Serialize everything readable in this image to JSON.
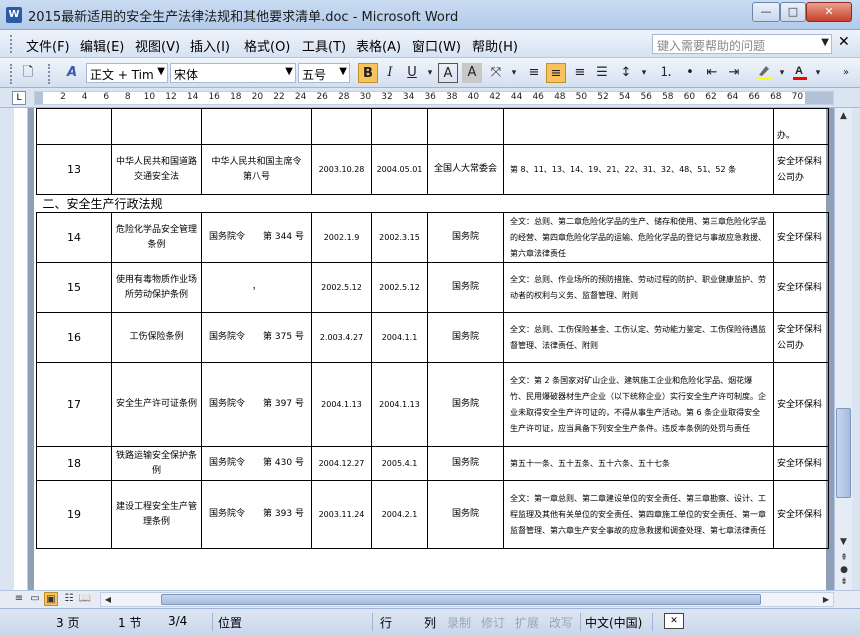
{
  "window": {
    "title": "2015最新适用的安全生产法律法规和其他要求清单.doc - Microsoft Word",
    "app_icon": "W",
    "minimize_glyph": "—",
    "maximize_glyph": "□",
    "close_glyph": "✕"
  },
  "menu": {
    "items": [
      "文件(F)",
      "编辑(E)",
      "视图(V)",
      "插入(I)",
      "格式(O)",
      "工具(T)",
      "表格(A)",
      "窗口(W)",
      "帮助(H)"
    ],
    "help_placeholder": "键入需要帮助的问题"
  },
  "toolbar": {
    "style": "正文 + Tim",
    "font": "宋体",
    "size": "五号",
    "bold": "B",
    "italic": "I",
    "underline": "U",
    "font_color_swatch": "#ff0000",
    "highlight_swatch": "#ffff00"
  },
  "ruler": {
    "corner": "L",
    "numbers": [
      "2",
      "4",
      "6",
      "8",
      "10",
      "12",
      "14",
      "16",
      "18",
      "20",
      "22",
      "24",
      "26",
      "28",
      "30",
      "32",
      "34",
      "36",
      "38",
      "40",
      "42",
      "44",
      "46",
      "48",
      "50",
      "52",
      "54",
      "56",
      "58",
      "60",
      "62",
      "64",
      "66",
      "68",
      "70"
    ]
  },
  "document": {
    "section_title": "二、安全生产行政法规",
    "top_row": {
      "dept": "办。"
    },
    "row13": {
      "no": "13",
      "name": "中华人民共和国道路交通安全法",
      "doc": "中华人民共和国主席令　　　第八号",
      "issued": "2003.10.28",
      "effective": "2004.05.01",
      "org": "全国人大常委会",
      "content": "第 8、11、13、14、19、21、22、31、32、48、51、52 条",
      "dept": "安全环保科　公司办"
    },
    "rows": [
      {
        "no": "14",
        "name": "危险化学品安全管理条例",
        "doc": "国务院令　　第 344 号",
        "issued": "2002.1.9",
        "effective": "2002.3.15",
        "org": "国务院",
        "content": "全文：总则、第二章危险化学品的生产、储存和使用、第三章危险化学品的经营、第四章危险化学品的运输、危险化学品的登记与事故应急救援、第六章法律责任",
        "dept": "安全环保科"
      },
      {
        "no": "15",
        "name": "使用有毒物质作业场所劳动保护条例",
        "doc": "，",
        "issued": "2002.5.12",
        "effective": "2002.5.12",
        "org": "国务院",
        "content": "全文：总则、作业场所的预防措施、劳动过程的防护、职业健康监护、劳动者的权利与义务、监督管理、附则",
        "dept": "安全环保科"
      },
      {
        "no": "16",
        "name": "工伤保险条例",
        "doc": "国务院令　　第 375 号",
        "issued": "2.003.4.27",
        "effective": "2004.1.1",
        "org": "国务院",
        "content": "全文：总则、工伤保险基金、工伤认定、劳动能力鉴定、工伤保险待遇监督管理、法律责任、附则",
        "dept": "安全环保科　公司办"
      },
      {
        "no": "17",
        "name": "安全生产许可证条例",
        "doc": "国务院令　　第 397 号",
        "issued": "2004.1.13",
        "effective": "2004.1.13",
        "org": "国务院",
        "content": "全文：第 2 条国家对矿山企业、建筑施工企业和危险化学品、烟花爆竹、民用爆破器材生产企业（以下统称企业）实行安全生产许可制度。企业未取得安全生产许可证的，不得从事生产活动。第 6 条企业取得安全生产许可证，应当具备下列安全生产条件。违反本条例的处罚与责任",
        "dept": "安全环保科"
      },
      {
        "no": "18",
        "name": "铁路运输安全保护条例",
        "doc": "国务院令　　第 430 号",
        "issued": "2004.12.27",
        "effective": "2005.4.1",
        "org": "国务院",
        "content": "第五十一条、五十五条、五十六条、五十七条",
        "dept": "安全环保科"
      },
      {
        "no": "19",
        "name": "建设工程安全生产管理条例",
        "doc": "国务院令　　第 393 号",
        "issued": "2003.11.24",
        "effective": "2004.2.1",
        "org": "国务院",
        "content": "全文：第一章总则、第二章建设单位的安全责任、第三章勘察、设计、工程监理及其他有关单位的安全责任、第四章施工单位的安全责任、第一章监督管理、第六章生产安全事故的应急救援和调查处理、第七章法律责任",
        "dept": "安全环保科"
      }
    ]
  },
  "status": {
    "page": "3 页",
    "section": "1 节",
    "pages": "3/4",
    "position": "位置",
    "line": "行",
    "column": "列",
    "rec": "录制",
    "trk": "修订",
    "ext": "扩展",
    "ovr": "改写",
    "language": "中文(中国)"
  }
}
